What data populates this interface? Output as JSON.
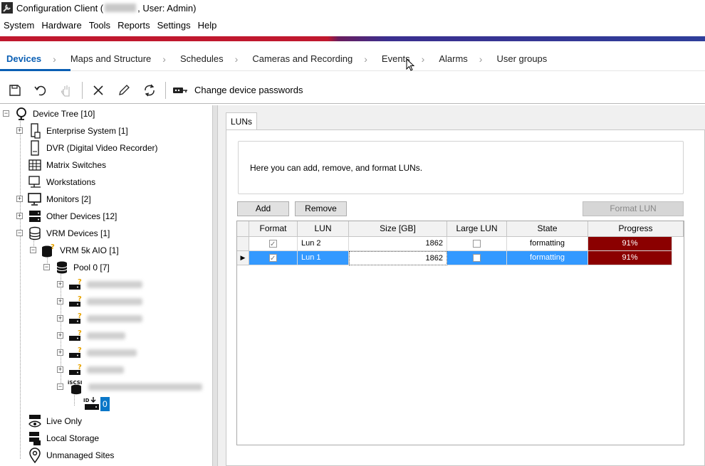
{
  "window": {
    "title_prefix": "Configuration Client (",
    "title_suffix": ", User: Admin)"
  },
  "menu": [
    "System",
    "Hardware",
    "Tools",
    "Reports",
    "Settings",
    "Help"
  ],
  "workflow": {
    "steps": [
      "Devices",
      "Maps and Structure",
      "Schedules",
      "Cameras and Recording",
      "Events",
      "Alarms",
      "User groups"
    ],
    "active": "Devices"
  },
  "toolbar": {
    "icons": [
      "save-icon",
      "undo-icon",
      "hand-icon",
      "delete-icon",
      "edit-icon",
      "refresh-icon",
      "password-icon"
    ],
    "change_passwords_label": "Change device passwords"
  },
  "tree": {
    "root": "Device Tree [10]",
    "enterprise": "Enterprise System [1]",
    "dvr": "DVR (Digital Video Recorder)",
    "matrix": "Matrix Switches",
    "workstations": "Workstations",
    "monitors": "Monitors [2]",
    "other": "Other Devices [12]",
    "vrm": "VRM Devices [1]",
    "vrm5k": "VRM 5k AIO [1]",
    "pool": "Pool 0 [7]",
    "iscsi_label": "iSCSI",
    "lun_zero": "0",
    "live_only": "Live Only",
    "local_storage": "Local Storage",
    "unmanaged": "Unmanaged Sites"
  },
  "panel": {
    "tab": "LUNs",
    "info": "Here you can add, remove, and format LUNs.",
    "add": "Add",
    "remove": "Remove",
    "format": "Format LUN"
  },
  "grid": {
    "columns": [
      "Format",
      "LUN",
      "Size [GB]",
      "Large LUN",
      "State",
      "Progress"
    ],
    "rows": [
      {
        "format": true,
        "lun": "Lun 2",
        "size": "1862",
        "large": false,
        "state": "formatting",
        "progress": "91%",
        "progress_value": 0.91
      },
      {
        "format": true,
        "lun": "Lun 1",
        "size": "1862",
        "large": false,
        "state": "formatting",
        "progress": "91%",
        "progress_value": 0.91
      }
    ]
  },
  "colors": {
    "accent": "#0a5fb4",
    "progress": "#8b0000",
    "selection": "#3399ff"
  }
}
